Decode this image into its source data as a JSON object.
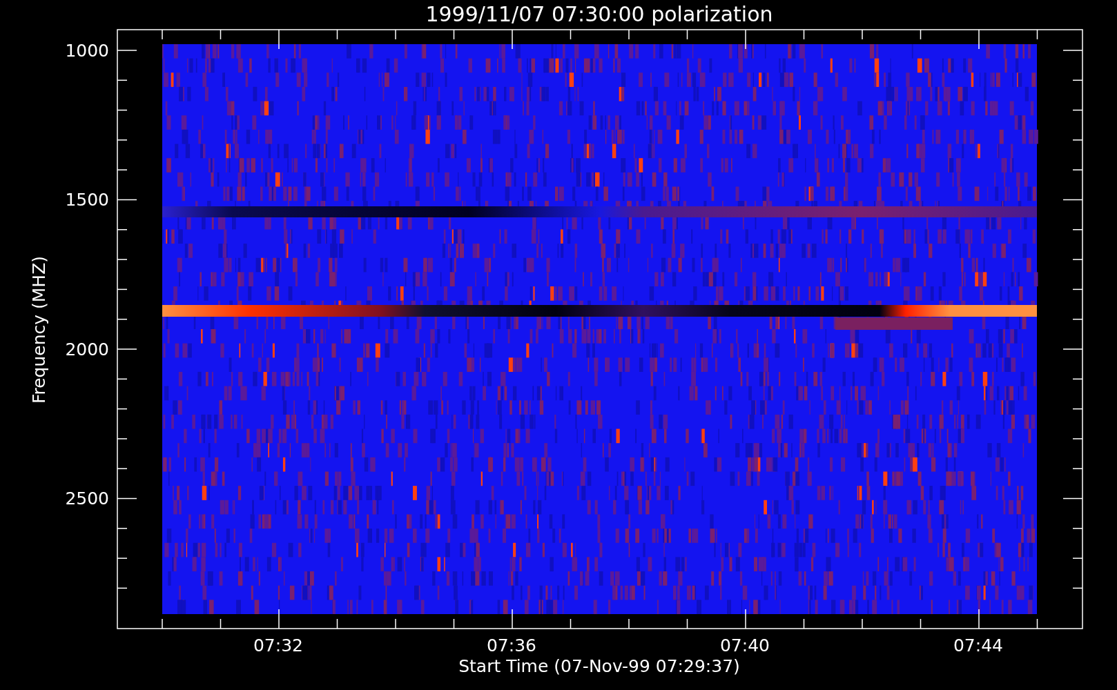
{
  "title": "1999/11/07 07:30:00 polarization",
  "y_axis": {
    "label": "Frequency (MHZ)",
    "ticks": [
      "1000",
      "1500",
      "2000",
      "2500"
    ]
  },
  "x_axis": {
    "label": "Start Time (07-Nov-99 07:29:37)",
    "ticks": [
      "07:32",
      "07:36",
      "07:40",
      "07:44"
    ]
  }
}
